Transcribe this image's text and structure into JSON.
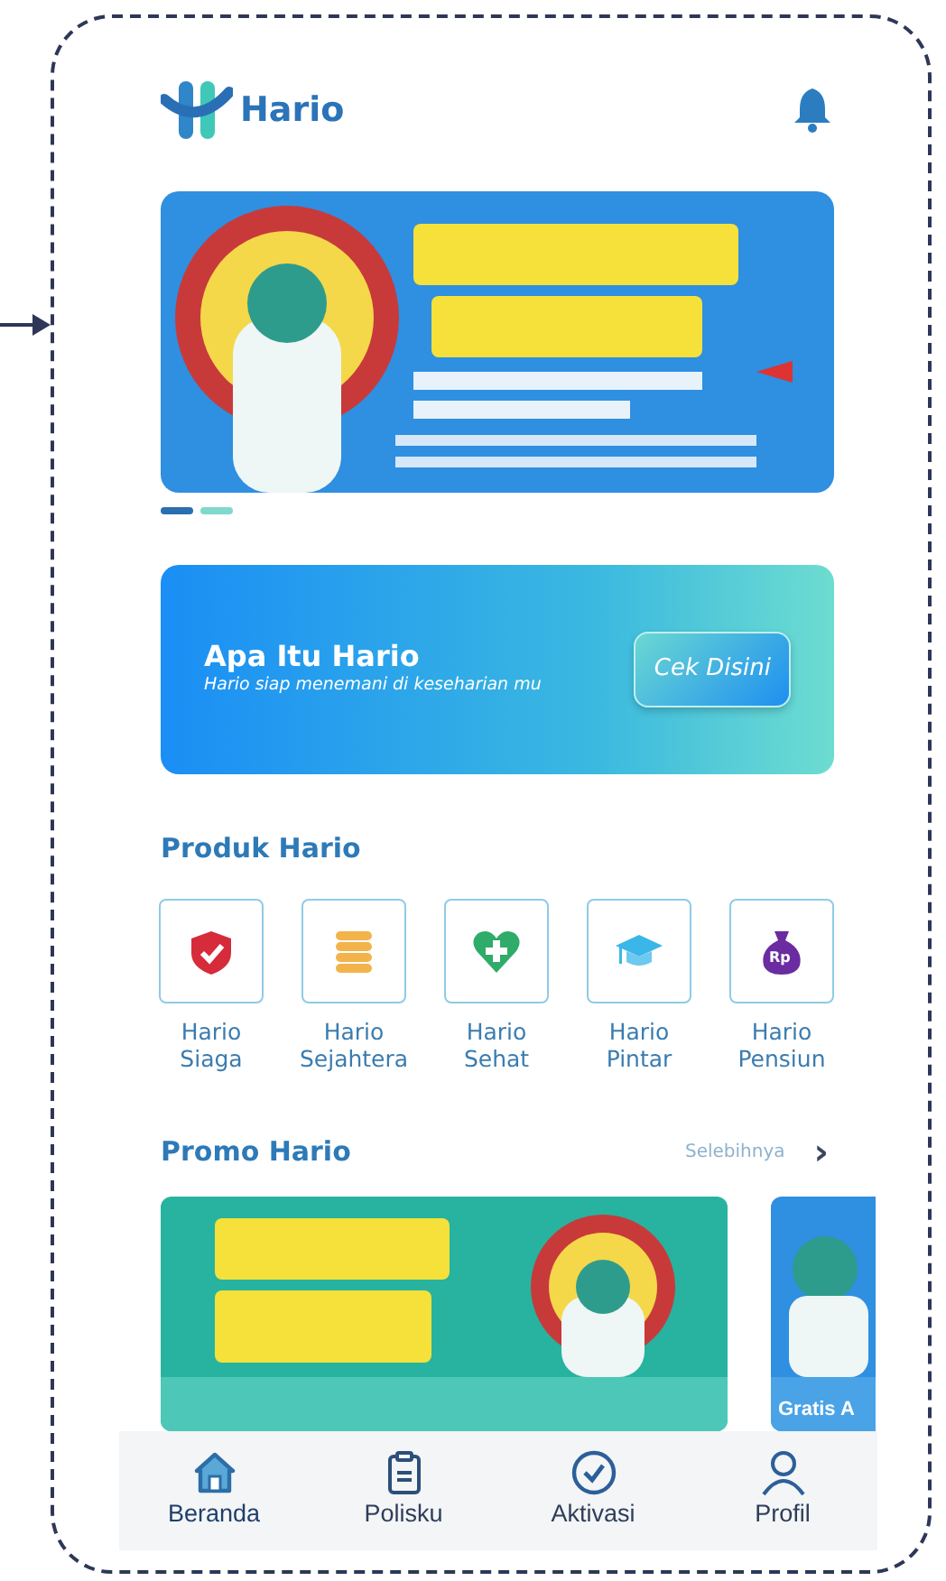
{
  "app": {
    "name": "Hario"
  },
  "banner": {
    "kind": "picture",
    "dots": [
      {
        "selected": true
      },
      {
        "selected": false
      }
    ]
  },
  "info_card": {
    "title": "Apa Itu Hario",
    "subtitle": "Hario siap menemani di keseharian mu",
    "button": "Cek Disini"
  },
  "products": {
    "title": "Produk Hario",
    "items": [
      {
        "kind": "shield",
        "label": "Hario Siaga"
      },
      {
        "kind": "coins",
        "label": "Hario Sejahtera"
      },
      {
        "kind": "heart",
        "label": "Hario Sehat"
      },
      {
        "kind": "cap",
        "label": "Hario Pintar"
      },
      {
        "kind": "moneybag",
        "label": "Hario Pensiun",
        "badge": "Rp"
      }
    ]
  },
  "promos": {
    "title": "Promo Hario",
    "more": "Selebihnya",
    "more_icon": "›",
    "items": [
      {
        "kind": "picture"
      },
      {
        "kind": "picture",
        "caption": "Gratis A"
      }
    ]
  },
  "bottom_nav": [
    {
      "kind": "home",
      "label": "Beranda",
      "selected": true
    },
    {
      "kind": "clipboard",
      "label": "Polisku",
      "selected": false
    },
    {
      "kind": "check",
      "label": "Aktivasi",
      "selected": false
    },
    {
      "kind": "person",
      "label": "Profil",
      "selected": false
    }
  ]
}
